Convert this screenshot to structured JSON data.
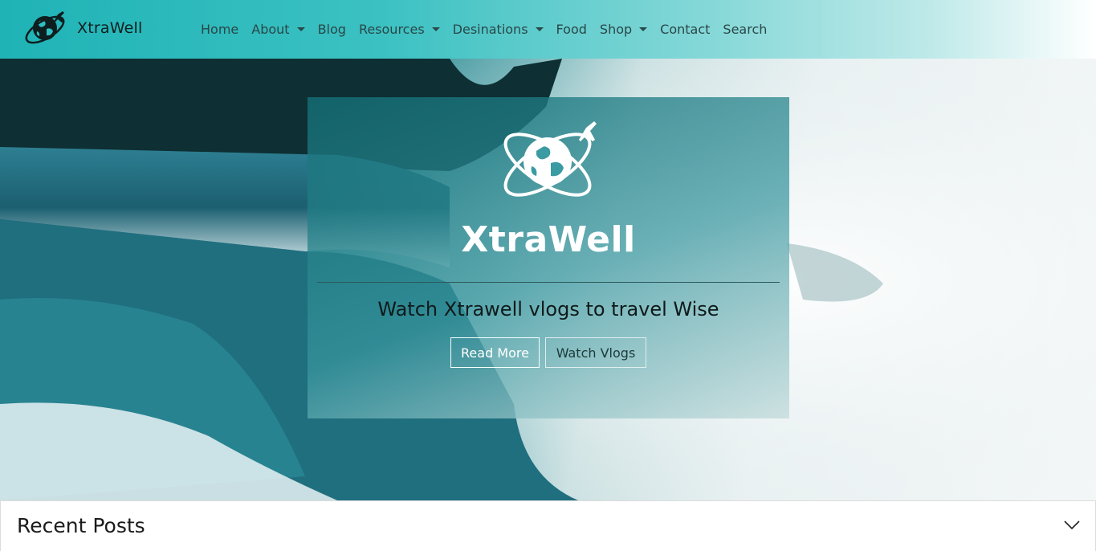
{
  "brand": {
    "name": "XtraWell",
    "logo_icon": "globe-plane-orbit-icon"
  },
  "nav": {
    "items": [
      {
        "label": "Home",
        "dropdown": false
      },
      {
        "label": "About",
        "dropdown": true
      },
      {
        "label": "Blog",
        "dropdown": false
      },
      {
        "label": "Resources",
        "dropdown": true
      },
      {
        "label": "Desinations",
        "dropdown": true
      },
      {
        "label": "Food",
        "dropdown": false
      },
      {
        "label": "Shop",
        "dropdown": true
      },
      {
        "label": "Contact",
        "dropdown": false
      },
      {
        "label": "Search",
        "dropdown": false
      }
    ]
  },
  "hero": {
    "title": "XtraWell",
    "subtitle": "Watch Xtrawell vlogs to travel Wise",
    "buttons": {
      "read_more": "Read More",
      "watch_vlogs": "Watch Vlogs"
    },
    "background_icon": "waterfall-photo"
  },
  "recent": {
    "title": "Recent Posts",
    "toggle_icon": "chevron-down-icon"
  },
  "colors": {
    "navbar": "#1fb3b6",
    "card": "#2a8f96",
    "accent": "#ffffff"
  }
}
